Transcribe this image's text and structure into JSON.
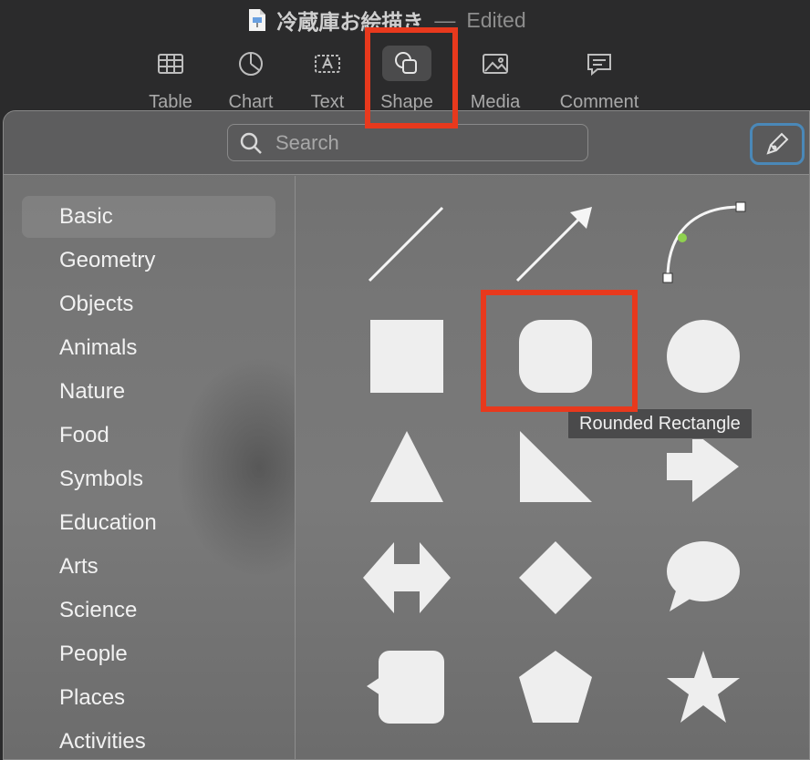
{
  "window": {
    "doc_name": "冷蔵庫お絵描き",
    "separator": "—",
    "status": "Edited"
  },
  "toolbar": [
    {
      "label": "Table",
      "icon": "table-icon"
    },
    {
      "label": "Chart",
      "icon": "chart-icon"
    },
    {
      "label": "Text",
      "icon": "text-box-icon"
    },
    {
      "label": "Shape",
      "icon": "shape-icon",
      "active": true
    },
    {
      "label": "Media",
      "icon": "media-icon"
    },
    {
      "label": "Comment",
      "icon": "comment-icon"
    }
  ],
  "search": {
    "placeholder": "Search",
    "value": ""
  },
  "pen_tool": {
    "icon": "pen-icon"
  },
  "categories": [
    "Basic",
    "Geometry",
    "Objects",
    "Animals",
    "Nature",
    "Food",
    "Symbols",
    "Education",
    "Arts",
    "Science",
    "People",
    "Places",
    "Activities"
  ],
  "selected_category": "Basic",
  "shapes": [
    "line",
    "arrow",
    "curve",
    "square",
    "rounded-rectangle",
    "circle",
    "triangle",
    "right-triangle",
    "arrow-right",
    "double-arrow",
    "diamond",
    "speech-bubble",
    "callout-square",
    "pentagon",
    "star"
  ],
  "tooltip": {
    "text": "Rounded Rectangle"
  },
  "colors": {
    "highlight": "#e8391d",
    "focus_ring": "#4a88b8",
    "shape_fill": "#eeeeee",
    "control_point": "#8fd14f"
  }
}
